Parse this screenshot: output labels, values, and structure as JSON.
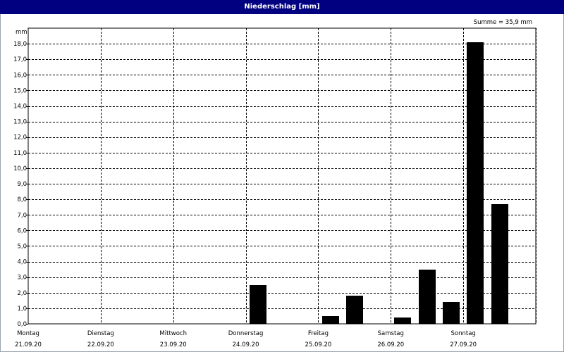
{
  "window": {
    "title": "Niederschlag [mm]"
  },
  "summary": "Summe = 35,9 mm",
  "chart_data": {
    "type": "bar",
    "title": "Niederschlag [mm]",
    "ylabel": "mm",
    "xlabel": "",
    "ylim": [
      0,
      19
    ],
    "yticks": [
      0,
      1,
      2,
      3,
      4,
      5,
      6,
      7,
      8,
      9,
      10,
      11,
      12,
      13,
      14,
      15,
      16,
      17,
      18
    ],
    "ytick_labels": [
      "0,0",
      "1,0",
      "2,0",
      "3,0",
      "4,0",
      "5,0",
      "6,0",
      "7,0",
      "8,0",
      "9,0",
      "10,0",
      "11,0",
      "12,0",
      "13,0",
      "14,0",
      "15,0",
      "16,0",
      "17,0",
      "18,0"
    ],
    "days": [
      {
        "name": "Montag",
        "date": "21.09.20"
      },
      {
        "name": "Dienstag",
        "date": "22.09.20"
      },
      {
        "name": "Mittwoch",
        "date": "23.09.20"
      },
      {
        "name": "Donnerstag",
        "date": "24.09.20"
      },
      {
        "name": "Freitag",
        "date": "25.09.20"
      },
      {
        "name": "Samstag",
        "date": "26.09.20"
      },
      {
        "name": "Sonntag",
        "date": "27.09.20"
      }
    ],
    "bars_per_day": 3,
    "values": [
      0,
      0,
      0,
      0,
      0,
      0,
      0,
      0,
      0,
      2.5,
      0,
      0,
      0.5,
      1.8,
      0,
      0.4,
      3.5,
      1.4,
      18.1,
      7.7,
      0
    ],
    "grid": true,
    "bar_color": "#000000",
    "title_bar_color": "#000080"
  }
}
